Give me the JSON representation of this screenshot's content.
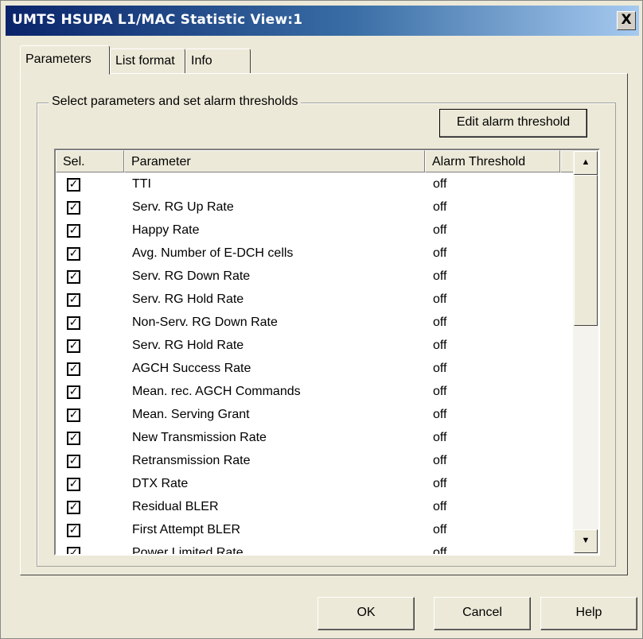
{
  "window": {
    "title": "UMTS HSUPA L1/MAC Statistic View:1",
    "close_glyph": "X"
  },
  "tabs": [
    {
      "label": "Parameters",
      "active": true
    },
    {
      "label": "List format",
      "active": false
    },
    {
      "label": "Info",
      "active": false
    }
  ],
  "group": {
    "label": "Select parameters and set alarm thresholds",
    "edit_button_label": "Edit alarm threshold"
  },
  "list": {
    "columns": [
      "Sel.",
      "Parameter",
      "Alarm Threshold"
    ],
    "check_glyph": "✓",
    "rows": [
      {
        "checked": true,
        "parameter": "TTI",
        "alarm": "off"
      },
      {
        "checked": true,
        "parameter": "Serv. RG Up Rate",
        "alarm": "off"
      },
      {
        "checked": true,
        "parameter": "Happy Rate",
        "alarm": "off"
      },
      {
        "checked": true,
        "parameter": "Avg. Number of E-DCH cells",
        "alarm": "off"
      },
      {
        "checked": true,
        "parameter": "Serv. RG Down Rate",
        "alarm": "off"
      },
      {
        "checked": true,
        "parameter": "Serv. RG Hold Rate",
        "alarm": "off"
      },
      {
        "checked": true,
        "parameter": "Non-Serv. RG Down Rate",
        "alarm": "off"
      },
      {
        "checked": true,
        "parameter": "Serv. RG Hold Rate",
        "alarm": "off"
      },
      {
        "checked": true,
        "parameter": "AGCH Success Rate",
        "alarm": "off"
      },
      {
        "checked": true,
        "parameter": "Mean. rec. AGCH Commands",
        "alarm": "off"
      },
      {
        "checked": true,
        "parameter": "Mean. Serving Grant",
        "alarm": "off"
      },
      {
        "checked": true,
        "parameter": "New Transmission Rate",
        "alarm": "off"
      },
      {
        "checked": true,
        "parameter": "Retransmission Rate",
        "alarm": "off"
      },
      {
        "checked": true,
        "parameter": "DTX Rate",
        "alarm": "off"
      },
      {
        "checked": true,
        "parameter": "Residual BLER",
        "alarm": "off"
      },
      {
        "checked": true,
        "parameter": "First Attempt BLER",
        "alarm": "off"
      },
      {
        "checked": true,
        "parameter": "Power Limited Rate",
        "alarm": "off"
      }
    ],
    "scroll_up_glyph": "▲",
    "scroll_down_glyph": "▼"
  },
  "footer": {
    "ok_label": "OK",
    "cancel_label": "Cancel",
    "help_label": "Help"
  }
}
